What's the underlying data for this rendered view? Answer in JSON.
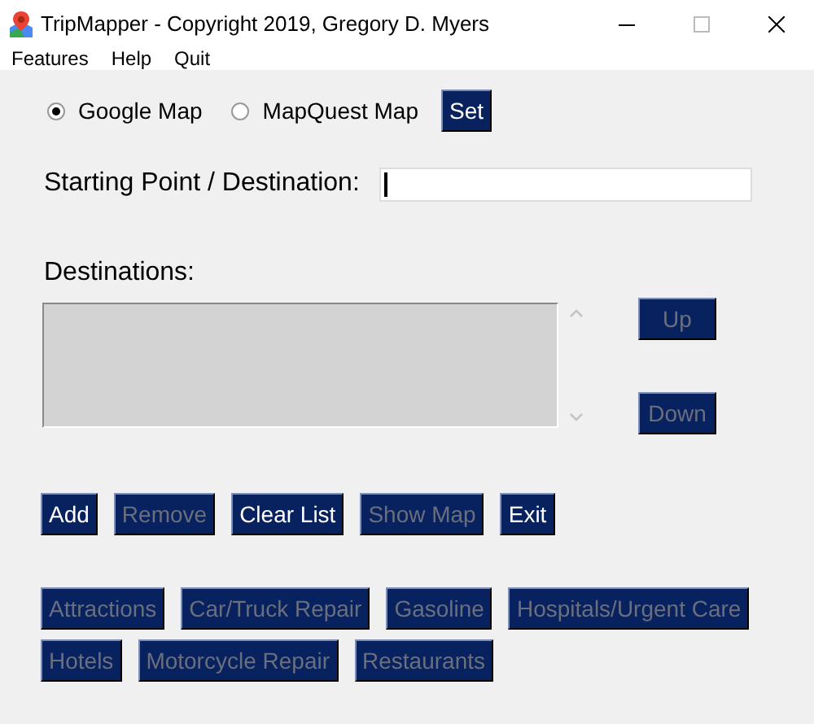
{
  "window": {
    "title": "TripMapper - Copyright 2019, Gregory D. Myers"
  },
  "menu": [
    "Features",
    "Help",
    "Quit"
  ],
  "map_options": [
    {
      "label": "Google Map",
      "selected": true
    },
    {
      "label": "MapQuest Map",
      "selected": false
    }
  ],
  "set_button": {
    "label": "Set",
    "disabled": false
  },
  "start_field": {
    "label": "Starting Point / Destination:"
  },
  "destinations": {
    "label": "Destinations:",
    "disabled": true
  },
  "move_buttons": [
    {
      "label": "Up",
      "disabled": true
    },
    {
      "label": "Down",
      "disabled": true
    }
  ],
  "actions": [
    {
      "label": "Add",
      "disabled": false
    },
    {
      "label": "Remove",
      "disabled": true
    },
    {
      "label": "Clear List",
      "disabled": false
    },
    {
      "label": "Show Map",
      "disabled": true
    },
    {
      "label": "Exit",
      "disabled": false
    }
  ],
  "categories": [
    [
      {
        "label": "Attractions",
        "disabled": true
      },
      {
        "label": "Car/Truck Repair",
        "disabled": true
      },
      {
        "label": "Gasoline",
        "disabled": true
      },
      {
        "label": "Hospitals/Urgent Care",
        "disabled": true
      }
    ],
    [
      {
        "label": "Hotels",
        "disabled": true
      },
      {
        "label": "Motorcycle Repair",
        "disabled": true
      },
      {
        "label": "Restaurants",
        "disabled": true
      }
    ]
  ]
}
